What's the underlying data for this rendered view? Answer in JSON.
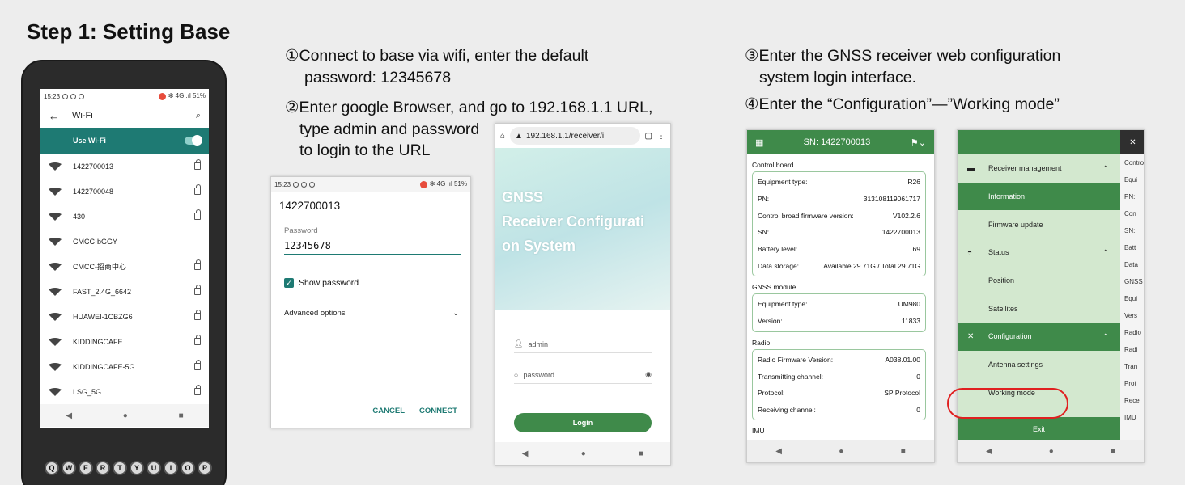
{
  "title": "Step 1: Setting Base",
  "steps": {
    "s1_line1": "①Connect to base via wifi, enter the default",
    "s1_line2": "password: 12345678",
    "s2_line1": "②Enter google Browser, and go to 192.168.1.1 URL,",
    "s2_line2": "type admin and password",
    "s2_line3": "to login to the URL",
    "s3_line1": "③Enter the GNSS receiver web configuration",
    "s3_line2": "system login interface.",
    "s4_line1": "④Enter the “Configuration”—”Working mode”"
  },
  "phone1": {
    "status_time": "15:23",
    "status_right": "✻ 4G .ıl 51%",
    "header_title": "Wi-Fi",
    "use_wifi_label": "Use Wi-Fi",
    "networks": [
      "1422700013",
      "1422700048",
      "430",
      "CMCC-bGGY",
      "CMCC-招商中心",
      "FAST_2.4G_6642",
      "HUAWEI-1CBZG6",
      "KIDDINGCAFE",
      "KIDDINGCAFE-5G",
      "LSG_5G"
    ],
    "nav": [
      "◀",
      "●",
      "■"
    ]
  },
  "keyboard": [
    "Q",
    "W",
    "E",
    "R",
    "T",
    "Y",
    "U",
    "I",
    "O",
    "P"
  ],
  "phone2": {
    "status_time": "15:23",
    "status_right": "✻ 4G .ıl 51%",
    "ssid": "1422700013",
    "password_label": "Password",
    "password_value": "12345678",
    "show_password": "Show password",
    "advanced": "Advanced options",
    "cancel": "CANCEL",
    "connect": "CONNECT"
  },
  "phone3": {
    "url": "192.168.1.1/receiver/i",
    "hero_l1": "GNSS",
    "hero_l2": "Receiver Configurati",
    "hero_l3": "on System",
    "user_placeholder": "admin",
    "pass_placeholder": "password",
    "login": "Login",
    "nav": [
      "◀",
      "●",
      "■"
    ]
  },
  "phone4": {
    "header_sn": "SN: 1422700013",
    "control_board": "Control board",
    "cb_rows": [
      {
        "k": "Equipment type:",
        "v": "R26"
      },
      {
        "k": "PN:",
        "v": "313108119061717"
      },
      {
        "k": "Control broad firmware version:",
        "v": "V102.2.6"
      },
      {
        "k": "SN:",
        "v": "1422700013"
      },
      {
        "k": "Battery level:",
        "v": "69"
      },
      {
        "k": "Data storage:",
        "v": "Available 29.71G / Total 29.71G"
      }
    ],
    "gnss_module": "GNSS module",
    "gnss_rows": [
      {
        "k": "Equipment type:",
        "v": "UM980"
      },
      {
        "k": "Version:",
        "v": "11833"
      }
    ],
    "radio": "Radio",
    "radio_rows": [
      {
        "k": "Radio Firmware Version:",
        "v": "A038.01.00"
      },
      {
        "k": "Transmitting channel:",
        "v": "0"
      },
      {
        "k": "Protocol:",
        "v": "SP Protocol"
      },
      {
        "k": "Receiving channel:",
        "v": "0"
      }
    ],
    "imu": "IMU",
    "nav": [
      "◀",
      "●",
      "■"
    ]
  },
  "phone5": {
    "receiver_management": "Receiver management",
    "information": "Information",
    "firmware_update": "Firmware update",
    "status": "Status",
    "position": "Position",
    "satellites": "Satellites",
    "configuration": "Configuration",
    "antenna_settings": "Antenna settings",
    "working_mode": "Working mode",
    "exit": "Exit",
    "side_labels": [
      "Contro",
      "Equi",
      "PN:",
      "Con",
      "SN:",
      "Batt",
      "Data",
      "GNSS",
      "Equi",
      "Vers",
      "Radio",
      "Radi",
      "Tran",
      "Prot",
      "Rece",
      "IMU"
    ],
    "nav": [
      "◀",
      "●",
      "■"
    ]
  },
  "colors": {
    "brand_green": "#3f8a4a",
    "teal": "#1e7a73",
    "highlight_red": "#e02020"
  }
}
